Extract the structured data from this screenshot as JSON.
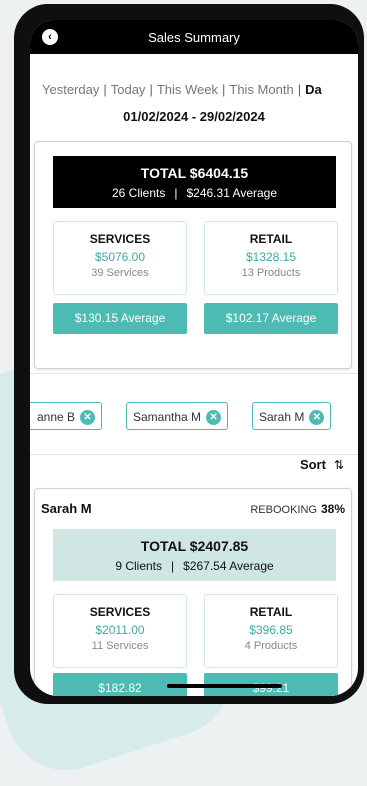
{
  "header": {
    "title": "Sales Summary"
  },
  "periods": [
    "Yesterday",
    "Today",
    "This Week",
    "This Month",
    "Da"
  ],
  "date_range": "01/02/2024 - 29/02/2024",
  "summary": {
    "total": "TOTAL $6404.15",
    "clients": "26 Clients",
    "average": "$246.31 Average",
    "services": {
      "label": "SERVICES",
      "value": "$5076.00",
      "count": "39 Services",
      "average": "$130.15 Average"
    },
    "retail": {
      "label": "RETAIL",
      "value": "$1328.15",
      "count": "13 Products",
      "average": "$102.17 Average"
    }
  },
  "staff_chips": [
    "anne B",
    "Samantha M",
    "Sarah M"
  ],
  "sort": {
    "label": "Sort",
    "icon": "sort-arrows-icon"
  },
  "staff": {
    "name": "Sarah M",
    "rebooking_label": "REBOOKING",
    "rebooking_value": "38%",
    "total": "TOTAL $2407.85",
    "clients": "9 Clients",
    "average": "$267.54 Average",
    "services": {
      "label": "SERVICES",
      "value": "$2011.00",
      "count": "11 Services",
      "average": "$182.82"
    },
    "retail": {
      "label": "RETAIL",
      "value": "$396.85",
      "count": "4 Products",
      "average": "$99.21"
    }
  },
  "colors": {
    "accent": "#4dbab3",
    "accent_light": "#cfe6e3",
    "header": "#000000"
  }
}
